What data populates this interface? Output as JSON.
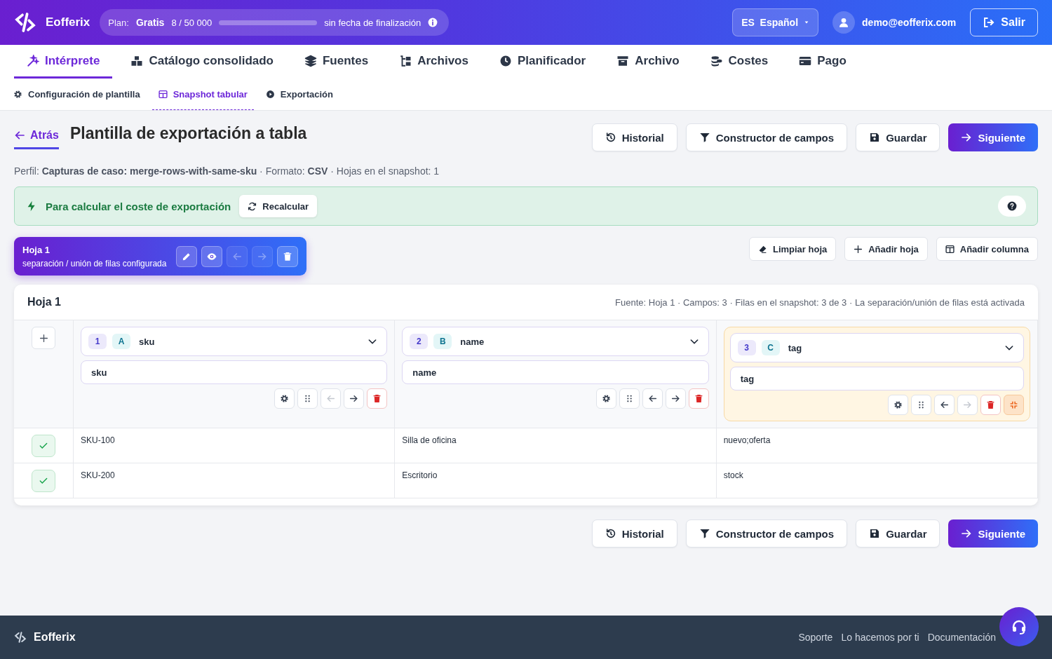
{
  "brand": "Eofferix",
  "plan": {
    "label": "Plan:",
    "name": "Gratis",
    "usage": "8 / 50 000",
    "level": 0.0002,
    "expiry": "sin fecha de finalización"
  },
  "language": {
    "code": "ES",
    "name": "Español"
  },
  "user": {
    "email": "demo@eofferix.com"
  },
  "logout": "Salir",
  "nav_tabs": [
    {
      "label": "Intérprete",
      "selected": true
    },
    {
      "label": "Catálogo consolidado",
      "selected": false
    },
    {
      "label": "Fuentes",
      "selected": false
    },
    {
      "label": "Archivos",
      "selected": false
    },
    {
      "label": "Planificador",
      "selected": false
    },
    {
      "label": "Archivo",
      "selected": false
    },
    {
      "label": "Costes",
      "selected": false
    },
    {
      "label": "Pago",
      "selected": false
    }
  ],
  "sub_tabs": [
    {
      "label": "Configuración de plantilla",
      "selected": false
    },
    {
      "label": "Snapshot tabular",
      "selected": true
    },
    {
      "label": "Exportación",
      "selected": false
    }
  ],
  "back": "Atrás",
  "title": "Plantilla de exportación a tabla",
  "actions": [
    {
      "label": "Historial",
      "kind": "default"
    },
    {
      "label": "Constructor de campos",
      "kind": "default"
    },
    {
      "label": "Guardar",
      "kind": "default"
    },
    {
      "label": "Siguiente",
      "kind": "primary"
    }
  ],
  "meta": "Perfil: **Capturas de caso: merge-rows-with-same-sku** · Formato: **CSV** · Hojas en el snapshot: 1",
  "notice": {
    "text": "Para calcular el coste de exportación",
    "button": "Recalcular"
  },
  "sheets": [
    {
      "name": "Hoja 1",
      "subtitle": "separación / unión de filas configurada",
      "selected": true,
      "can_move_left": false,
      "can_move_right": false
    }
  ],
  "sheet_tools": [
    "Limpiar hoja",
    "Añadir hoja",
    "Añadir columna"
  ],
  "table": {
    "title": "Hoja 1",
    "info": "Fuente: Hoja 1 · Campos: 3 · Filas en el snapshot: 3 de 3 · La separación/unión de filas está activada",
    "columns": [
      {
        "index": "1",
        "letter": "A",
        "field": "sku",
        "header": "sku",
        "selected": false,
        "can_move_left": false,
        "can_move_right": true
      },
      {
        "index": "2",
        "letter": "B",
        "field": "name",
        "header": "name",
        "selected": false,
        "can_move_left": true,
        "can_move_right": true
      },
      {
        "index": "3",
        "letter": "C",
        "field": "tag",
        "header": "tag",
        "selected": true,
        "can_move_left": true,
        "can_move_right": false
      }
    ],
    "rows": [
      {
        "checked": true,
        "cells": [
          "SKU-100",
          "Silla de oficina",
          "nuevo;oferta"
        ]
      },
      {
        "checked": true,
        "cells": [
          "SKU-200",
          "Escritorio",
          "stock"
        ]
      }
    ]
  },
  "bottom_actions": [
    {
      "label": "Historial",
      "kind": "default"
    },
    {
      "label": "Constructor de campos",
      "kind": "default"
    },
    {
      "label": "Guardar",
      "kind": "default"
    },
    {
      "label": "Siguiente",
      "kind": "primary"
    }
  ],
  "footer": {
    "brand": "Eofferix",
    "links": [
      "Soporte",
      "Lo hacemos por ti",
      "Documentación"
    ]
  }
}
